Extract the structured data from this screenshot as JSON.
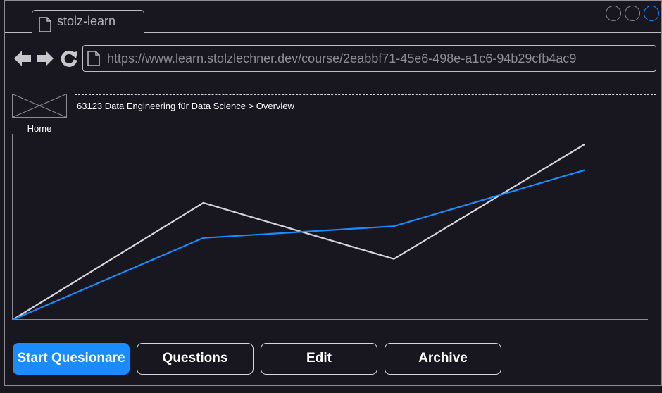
{
  "browser": {
    "tab_title": "stolz-learn",
    "url": "https://www.learn.stolzlechner.dev/course/2eabbf71-45e6-498e-a1c6-94b29cfb4ac9"
  },
  "page": {
    "home_label": "Home",
    "breadcrumb": "63123 Data Engineering für Data Science > Overview"
  },
  "chart_data": {
    "type": "line",
    "x": [
      0,
      1,
      2,
      3
    ],
    "series": [
      {
        "color": "#d8d6dc",
        "values": [
          0,
          0.5,
          0.26,
          0.75
        ]
      },
      {
        "color": "#1a8cff",
        "values": [
          0,
          0.35,
          0.4,
          0.64
        ]
      }
    ],
    "title": "",
    "xlabel": "",
    "ylabel": "",
    "ylim": [
      0,
      1
    ],
    "grid": false
  },
  "actions": {
    "start_label": "Start Quesionare",
    "questions_label": "Questions",
    "edit_label": "Edit",
    "archive_label": "Archive"
  },
  "colors": {
    "accent": "#1a8cff",
    "background": "#18161e"
  }
}
